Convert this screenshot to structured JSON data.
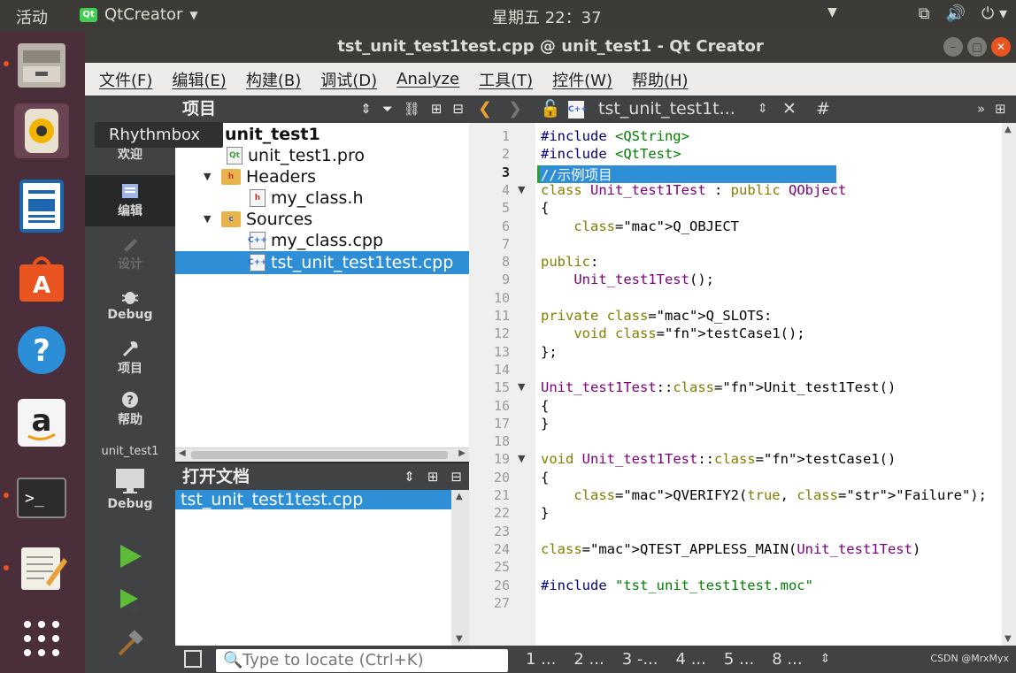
{
  "system": {
    "activities": "活动",
    "app_menu": "QtCreator",
    "clock": "星期五 22：37"
  },
  "window": {
    "title": "tst_unit_test1test.cpp @ unit_test1 - Qt Creator"
  },
  "menu": [
    "文件(F)",
    "编辑(E)",
    "构建(B)",
    "调试(D)",
    "Analyze",
    "工具(T)",
    "控件(W)",
    "帮助(H)"
  ],
  "tooltip": "Rhythmbox",
  "modes": {
    "welcome": "欢迎",
    "edit": "编辑",
    "design": "设计",
    "debug": "Debug",
    "projects": "项目",
    "help": "帮助",
    "kit_project": "unit_test1",
    "kit_mode": "Debug"
  },
  "project_pane": {
    "title": "项目",
    "tree": {
      "root": "unit_test1",
      "pro": "unit_test1.pro",
      "headers": "Headers",
      "header_file": "my_class.h",
      "sources": "Sources",
      "source1": "my_class.cpp",
      "source2": "tst_unit_test1test.cpp"
    }
  },
  "open_docs": {
    "title": "打开文档",
    "items": [
      "tst_unit_test1test.cpp"
    ]
  },
  "editor": {
    "tab": "tst_unit_test1t...",
    "hash": "#",
    "lines": [
      "#include <QString>",
      "#include <QtTest>",
      "//示例项目",
      "class Unit_test1Test : public QObject",
      "{",
      "    Q_OBJECT",
      "",
      "public:",
      "    Unit_test1Test();",
      "",
      "private Q_SLOTS:",
      "    void testCase1();",
      "};",
      "",
      "Unit_test1Test::Unit_test1Test()",
      "{",
      "}",
      "",
      "void Unit_test1Test::testCase1()",
      "{",
      "    QVERIFY2(true, \"Failure\");",
      "}",
      "",
      "QTEST_APPLESS_MAIN(Unit_test1Test)",
      "",
      "#include \"tst_unit_test1test.moc\"",
      ""
    ],
    "line_numbers": [
      "1",
      "2",
      "3",
      "4",
      "5",
      "6",
      "7",
      "8",
      "9",
      "10",
      "11",
      "12",
      "13",
      "14",
      "15",
      "16",
      "17",
      "18",
      "19",
      "20",
      "21",
      "22",
      "23",
      "24",
      "25",
      "26",
      "27"
    ]
  },
  "statusbar": {
    "locate_placeholder": "Type to locate (Ctrl+K)",
    "panes": [
      "1 ...",
      "2 ...",
      "3 -...",
      "4 ...",
      "5 ...",
      "8 ..."
    ],
    "watermark": "CSDN @MrxMyx"
  },
  "colors": {
    "accent": "#2f8fd6",
    "ubuntu_orange": "#e95420",
    "launcher": "#4a2f3a"
  }
}
